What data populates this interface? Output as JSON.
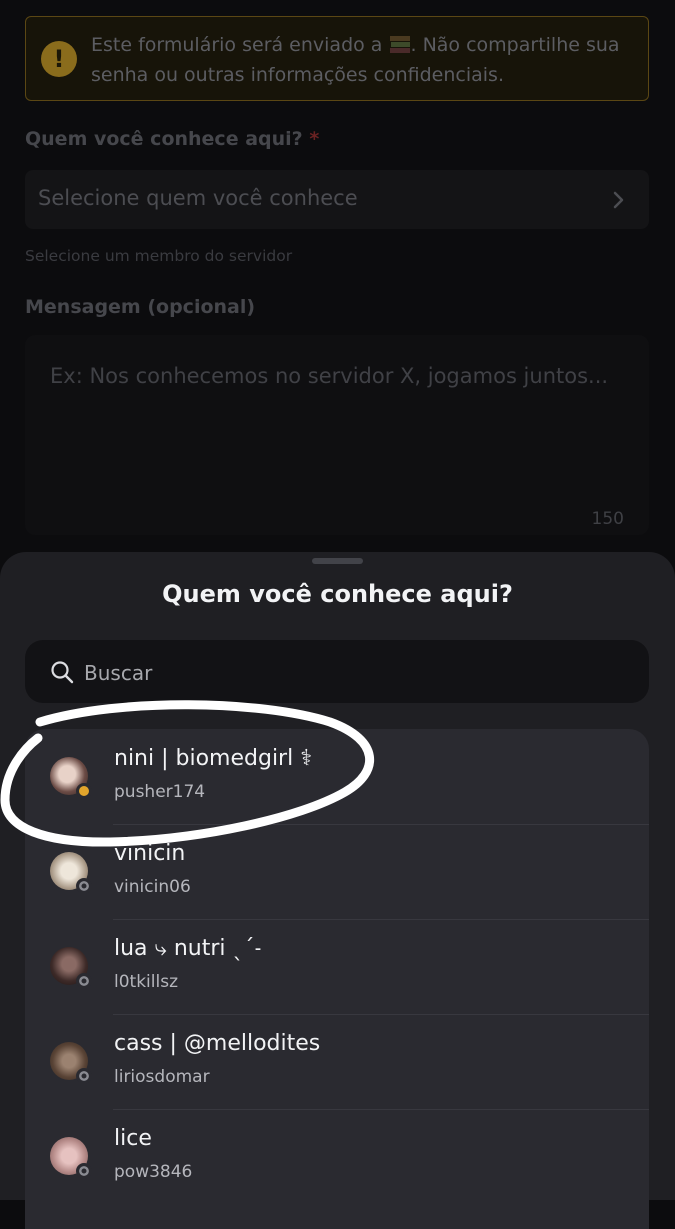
{
  "form": {
    "warning_text_before": "Este formulário será enviado a",
    "warning_text_after": ". Não compartilhe sua senha ou outras informações confidenciais.",
    "warning_icon": "exclamation-icon",
    "member_label": "Quem você conhece aqui?",
    "required_mark": "*",
    "member_placeholder": "Selecione quem você conhece",
    "member_helper": "Selecione um membro do servidor",
    "message_label": "Mensagem (opcional)",
    "message_placeholder": "Ex: Nos conhecemos no servidor X, jogamos juntos...",
    "message_counter": "150"
  },
  "sheet": {
    "title": "Quem você conhece aqui?",
    "search_placeholder": "Buscar",
    "members": [
      {
        "display_name": "nini | biomedgirl ⚕",
        "username": "pusher174",
        "status": "idle",
        "avatar_color": "#b07f6f"
      },
      {
        "display_name": "vinicin",
        "username": "vinicin06",
        "status": "offline",
        "avatar_color": "#c8b9a6"
      },
      {
        "display_name": "lua ⤷ nutri ˎˊ˗",
        "username": "l0tkillsz",
        "status": "offline",
        "avatar_color": "#5a3e3a"
      },
      {
        "display_name": "cass | @mellodites",
        "username": "liriosdomar",
        "status": "offline",
        "avatar_color": "#6b5446"
      },
      {
        "display_name": "lice",
        "username": "pow3846",
        "status": "offline",
        "avatar_color": "#c99a9a"
      }
    ]
  },
  "colors": {
    "sheet_bg": "#1f1f23",
    "list_bg": "#2a2a30",
    "warning_border": "#5b4714",
    "idle_status": "#e2a52c",
    "annotation_circle": "#ffffff"
  }
}
